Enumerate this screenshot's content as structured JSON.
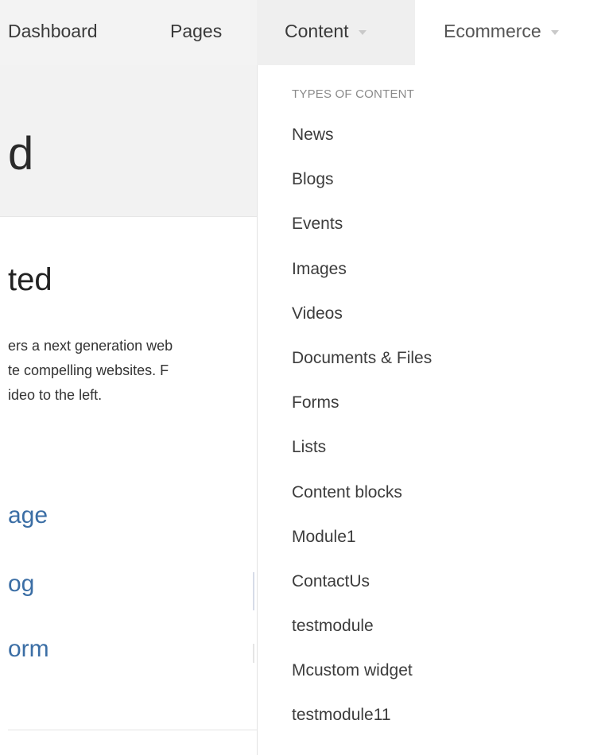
{
  "nav": {
    "dashboard": "Dashboard",
    "pages": "Pages",
    "content": "Content",
    "ecommerce": "Ecommerce"
  },
  "page": {
    "title_fragment": "d",
    "section_title_fragment": "ted",
    "paragraph_lines": [
      "ers a next generation web",
      "te compelling websites. F",
      "ideo to the left."
    ],
    "links": [
      "age",
      "og",
      "orm"
    ]
  },
  "dropdown": {
    "header": "TYPES OF CONTENT",
    "items": [
      "News",
      "Blogs",
      "Events",
      "Images",
      "Videos",
      "Documents & Files",
      "Forms",
      "Lists",
      "Content blocks",
      "Module1",
      "ContactUs",
      "testmodule",
      "Mcustom widget",
      "testmodule11"
    ]
  },
  "colors": {
    "link": "#3b6ea5",
    "nav_bg": "#f3f3f3",
    "caret": "#c9c9c9"
  }
}
